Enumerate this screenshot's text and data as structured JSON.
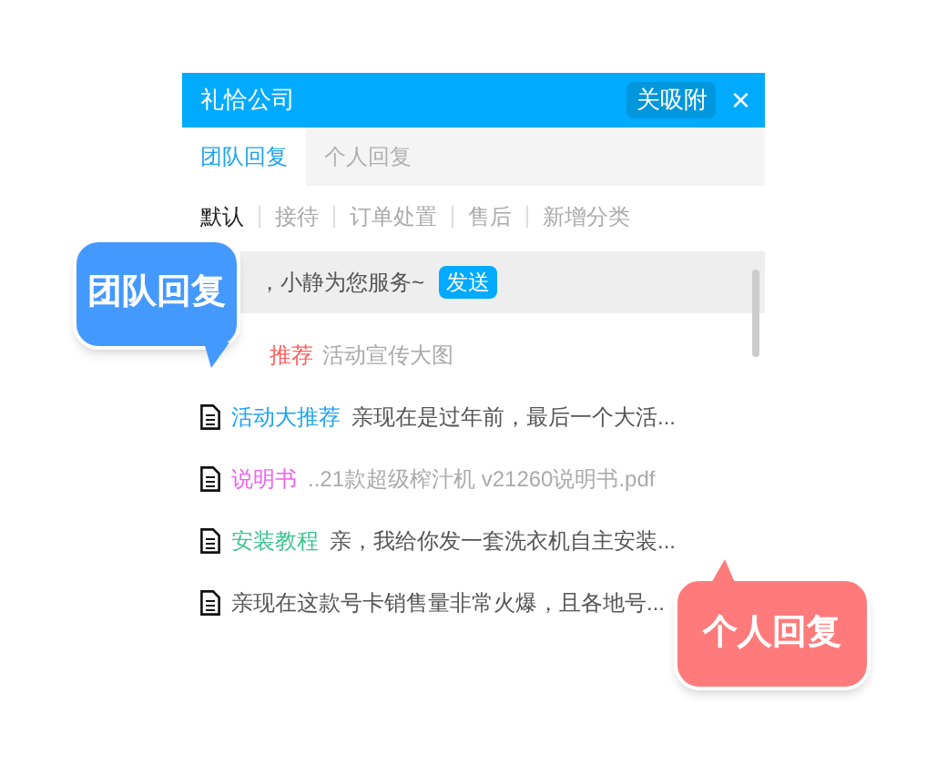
{
  "header": {
    "title": "礼恰公司",
    "pin_button": "关吸附",
    "close": "×"
  },
  "tabs": [
    {
      "label": "团队回复",
      "selected": true
    },
    {
      "label": "个人回复",
      "selected": false
    }
  ],
  "categories": [
    {
      "label": "默认",
      "selected": true
    },
    {
      "label": "接待",
      "selected": false
    },
    {
      "label": "订单处置",
      "selected": false
    },
    {
      "label": "售后",
      "selected": false
    },
    {
      "label": "新增分类",
      "selected": false
    }
  ],
  "replies": [
    {
      "kind": "quick",
      "text": "，小静为您服务~",
      "send": "发送",
      "selected": true
    },
    {
      "kind": "tagged",
      "tag": "推荐",
      "color": "#ff5b5b",
      "text": "活动宣传大图",
      "muted": true,
      "selected": false
    },
    {
      "kind": "doc",
      "tag": "活动大推荐",
      "color": "#1aa3f0",
      "text": "亲现在是过年前，最后一个大活...",
      "muted": false,
      "selected": false
    },
    {
      "kind": "doc",
      "tag": "说明书",
      "color": "#f060f0",
      "text": "..21款超级榨汁机 v21260说明书.pdf",
      "muted": true,
      "selected": false
    },
    {
      "kind": "doc",
      "tag": "安装教程",
      "color": "#3cc48c",
      "text": "亲，我给你发一套洗衣机自主安装...",
      "muted": false,
      "selected": false
    },
    {
      "kind": "doc",
      "text": "亲现在这款号卡销售量非常火爆，且各地号...",
      "muted": false,
      "selected": false
    }
  ],
  "callouts": [
    {
      "kind": "team",
      "label": "团队回复"
    },
    {
      "kind": "personal",
      "label": "个人回复"
    }
  ]
}
